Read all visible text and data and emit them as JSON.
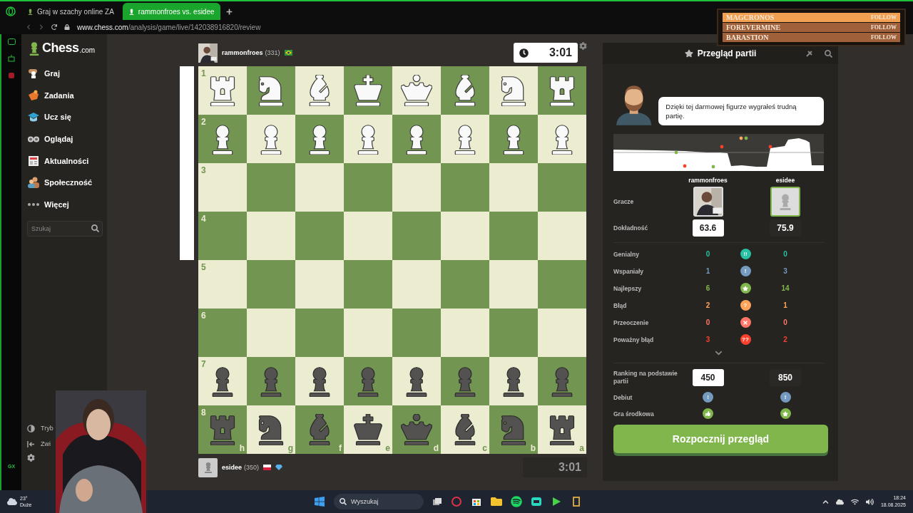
{
  "browser": {
    "tabs": [
      {
        "label": "Graj w szachy online ZA",
        "selected": false
      },
      {
        "label": "rammonfroes vs. esidee",
        "selected": true
      }
    ],
    "url_host": "www.chess.com",
    "url_path": "/analysis/game/live/142038916820/review"
  },
  "stream_overlay": {
    "entries": [
      {
        "name": "MAGCRONOS",
        "action": "FOLLOW",
        "selected": true
      },
      {
        "name": "FOREVERMINE",
        "action": "FOLLOW",
        "selected": false
      },
      {
        "name": "BARASTION",
        "action": "FOLLOW",
        "selected": false
      }
    ]
  },
  "sidebar": {
    "logo_main": "Chess",
    "logo_suffix": ".com",
    "items": [
      {
        "kind": "play",
        "label": "Graj"
      },
      {
        "kind": "puzzles",
        "label": "Zadania"
      },
      {
        "kind": "learn",
        "label": "Ucz się"
      },
      {
        "kind": "watch",
        "label": "Oglądaj"
      },
      {
        "kind": "news",
        "label": "Aktualności"
      },
      {
        "kind": "social",
        "label": "Społeczność"
      },
      {
        "kind": "more",
        "label": "Więcej"
      }
    ],
    "search": {
      "placeholder": "Szukaj"
    },
    "bottom_items": [
      {
        "kind": "theme",
        "label": "Tryb"
      },
      {
        "kind": "collapse",
        "label": "Zwi"
      }
    ]
  },
  "top_player": {
    "name": "rammonfroes",
    "rating": "(331)",
    "flags": [
      {
        "kind": "brazil"
      }
    ],
    "clock": "3:01",
    "clock_active": true
  },
  "board": {
    "eval": {
      "level": 0.5
    },
    "ranks": [
      "1",
      "2",
      "3",
      "4",
      "5",
      "6",
      "7",
      "8"
    ],
    "files": [
      "h",
      "g",
      "f",
      "e",
      "d",
      "c",
      "b",
      "a"
    ],
    "rows": [
      [
        {
          "kind": "rook",
          "black": false
        },
        {
          "kind": "knight",
          "black": false
        },
        {
          "kind": "bishop",
          "black": false
        },
        {
          "kind": "king",
          "black": false
        },
        {
          "kind": "queen",
          "black": false
        },
        {
          "kind": "bishop",
          "black": false
        },
        {
          "kind": "knight",
          "black": false
        },
        {
          "kind": "rook",
          "black": false
        }
      ],
      [
        {
          "kind": "pawn",
          "black": false
        },
        {
          "kind": "pawn",
          "black": false
        },
        {
          "kind": "pawn",
          "black": false
        },
        {
          "kind": "pawn",
          "black": false
        },
        {
          "kind": "pawn",
          "black": false
        },
        {
          "kind": "pawn",
          "black": false
        },
        {
          "kind": "pawn",
          "black": false
        },
        {
          "kind": "pawn",
          "black": false
        }
      ],
      [
        null,
        null,
        null,
        null,
        null,
        null,
        null,
        null
      ],
      [
        null,
        null,
        null,
        null,
        null,
        null,
        null,
        null
      ],
      [
        null,
        null,
        null,
        null,
        null,
        null,
        null,
        null
      ],
      [
        null,
        null,
        null,
        null,
        null,
        null,
        null,
        null
      ],
      [
        {
          "kind": "pawn",
          "black": true
        },
        {
          "kind": "pawn",
          "black": true
        },
        {
          "kind": "pawn",
          "black": true
        },
        {
          "kind": "pawn",
          "black": true
        },
        {
          "kind": "pawn",
          "black": true
        },
        {
          "kind": "pawn",
          "black": true
        },
        {
          "kind": "pawn",
          "black": true
        },
        {
          "kind": "pawn",
          "black": true
        }
      ],
      [
        {
          "kind": "rook",
          "black": true
        },
        {
          "kind": "knight",
          "black": true
        },
        {
          "kind": "bishop",
          "black": true
        },
        {
          "kind": "king",
          "black": true
        },
        {
          "kind": "queen",
          "black": true
        },
        {
          "kind": "bishop",
          "black": true
        },
        {
          "kind": "knight",
          "black": true
        },
        {
          "kind": "rook",
          "black": true
        }
      ]
    ]
  },
  "bottom_player": {
    "name": "esidee",
    "rating": "(350)",
    "avatar": {
      "kind": "pawn"
    },
    "flags": [
      {
        "kind": "poland"
      },
      {
        "kind": "diamond"
      }
    ],
    "clock": "3:01",
    "clock_active": false
  },
  "review": {
    "title": "Przegląd partii",
    "coach_message": "Dzięki tej darmowej figurze wygrałeś trudną partię.",
    "players": [
      {
        "name": "rammonfroes",
        "accuracy": "63.6",
        "rating": "450",
        "highlighted": false
      },
      {
        "name": "esidee",
        "avatar": {
          "kind": "pawn"
        },
        "accuracy": "75.9",
        "rating": "850",
        "highlighted": true
      }
    ],
    "players_label": "Gracze",
    "accuracy_label": "Dokładność",
    "classifications": [
      {
        "label": "Genialny",
        "white": "0",
        "black": "0",
        "kind": "brilliant",
        "symbol": "!!",
        "color": "#26c2a3"
      },
      {
        "label": "Wspaniały",
        "white": "1",
        "black": "3",
        "kind": "great",
        "symbol": "!",
        "color": "#749bbf"
      },
      {
        "label": "Najlepszy",
        "white": "6",
        "black": "14",
        "kind": "best",
        "color": "#81b64c"
      },
      {
        "label": "Błąd",
        "white": "2",
        "black": "1",
        "kind": "mistake",
        "symbol": "?",
        "color": "#ffa459"
      },
      {
        "label": "Przeoczenie",
        "white": "0",
        "black": "0",
        "kind": "miss",
        "color": "#ff7769"
      },
      {
        "label": "Poważny błąd",
        "white": "3",
        "black": "2",
        "kind": "blunder",
        "symbol": "??",
        "color": "#fa412d"
      }
    ],
    "rating_label": "Ranking na podstawie partii",
    "phases": [
      {
        "label": "Debiut",
        "white": {
          "kind": "great",
          "symbol": "!"
        },
        "black": {
          "kind": "great",
          "symbol": "!"
        }
      },
      {
        "label": "Gra środkowa",
        "white": {
          "kind": "good"
        },
        "black": {
          "kind": "best"
        }
      }
    ],
    "button": "Rozpocznij przegląd"
  },
  "taskbar": {
    "weather_temp": "23°",
    "weather_text": "Duże",
    "search_placeholder": "Wyszukaj",
    "time": "18:24",
    "date": "18.08.2025"
  },
  "rail": {
    "badge": "GX"
  }
}
